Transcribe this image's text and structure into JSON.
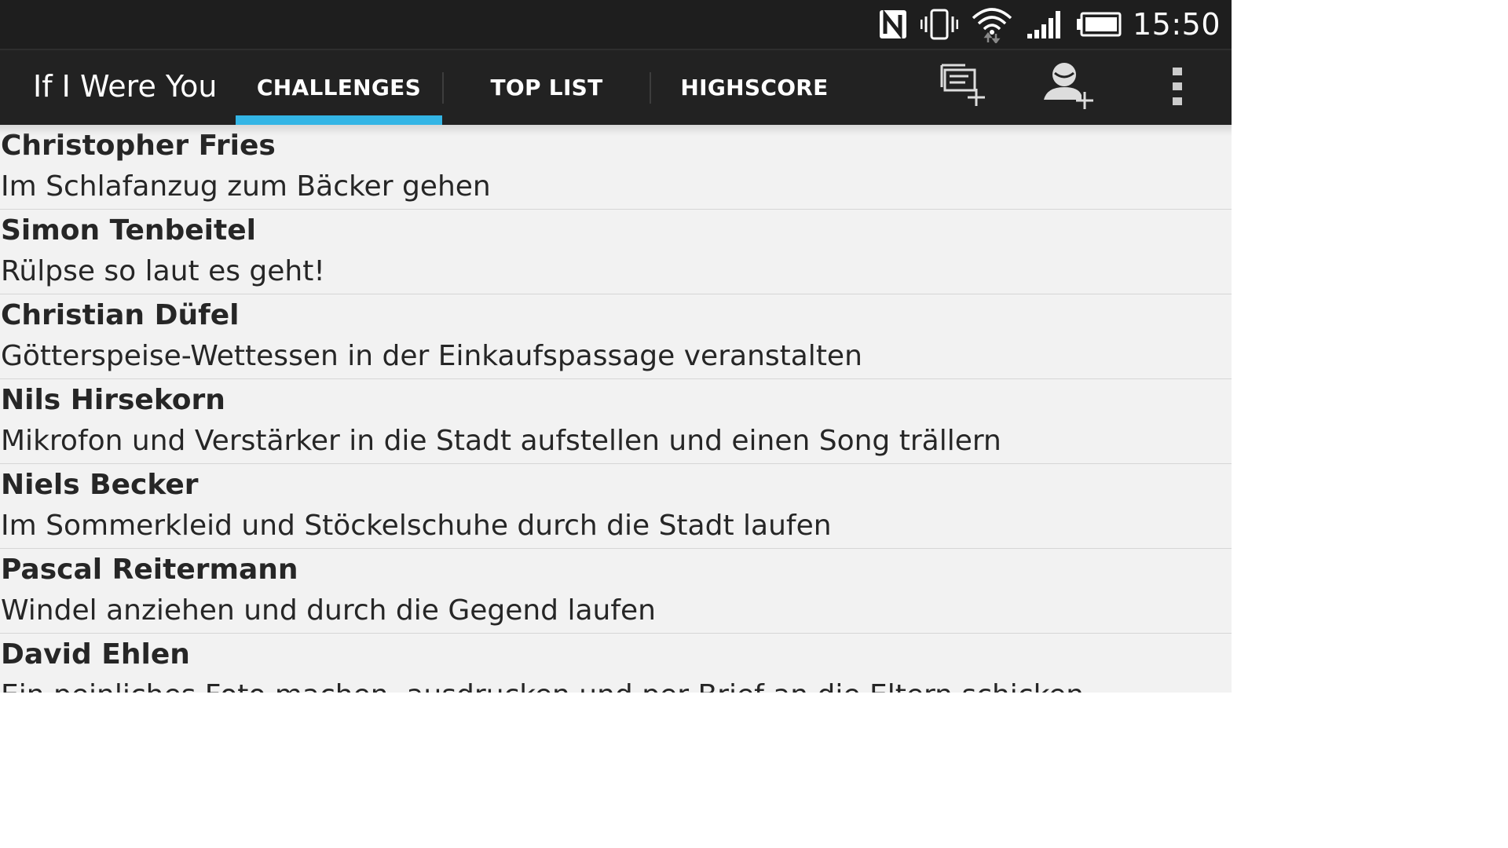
{
  "status_bar": {
    "icons": [
      "nfc-icon",
      "vibrate-icon",
      "wifi-icon",
      "signal-icon",
      "battery-icon"
    ],
    "time": "15:50"
  },
  "action_bar": {
    "app_title": "If I Were You",
    "tabs": [
      {
        "label": "CHALLENGES",
        "selected": true
      },
      {
        "label": "TOP LIST",
        "selected": false
      },
      {
        "label": "HIGHSCORE",
        "selected": false
      }
    ],
    "actions": [
      "add-challenge-icon",
      "add-friend-icon",
      "overflow-menu-icon"
    ]
  },
  "colors": {
    "accent": "#33b5e5",
    "bar_background": "#222222",
    "list_background": "#f2f2f2"
  },
  "challenges": [
    {
      "name": "Christopher Fries",
      "text": "Im Schlafanzug zum Bäcker gehen"
    },
    {
      "name": "Simon Tenbeitel",
      "text": "Rülpse so laut es geht!"
    },
    {
      "name": "Christian Düfel",
      "text": "Götterspeise-Wettessen in der Einkaufspassage veranstalten"
    },
    {
      "name": "Nils Hirsekorn",
      "text": "Mikrofon und Verstärker in die Stadt aufstellen und einen Song trällern"
    },
    {
      "name": "Niels Becker",
      "text": "Im Sommerkleid und Stöckelschuhe durch die Stadt laufen"
    },
    {
      "name": "Pascal Reitermann",
      "text": "Windel anziehen und durch die Gegend laufen"
    },
    {
      "name": "David Ehlen",
      "text": "Ein peinliches Foto machen, ausdrucken und per Brief an die Eltern schicken"
    }
  ]
}
